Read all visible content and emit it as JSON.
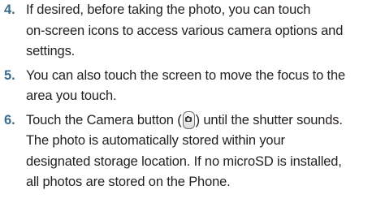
{
  "steps": [
    {
      "number": "4.",
      "lines": [
        "If desired, before taking the photo, you can touch",
        "on-screen icons to access various camera options and",
        "settings."
      ]
    },
    {
      "number": "5.",
      "lines": [
        "You can also touch the screen to move the focus to the",
        "area you touch."
      ]
    },
    {
      "number": "6.",
      "first_line_before": "Touch the Camera button (",
      "first_line_after": ") until the shutter sounds.",
      "inline_icon": "camera-button-icon",
      "lines": [
        "The photo is automatically stored within your",
        "designated storage location. If no microSD is installed,",
        "all photos are stored on the Phone."
      ]
    }
  ]
}
